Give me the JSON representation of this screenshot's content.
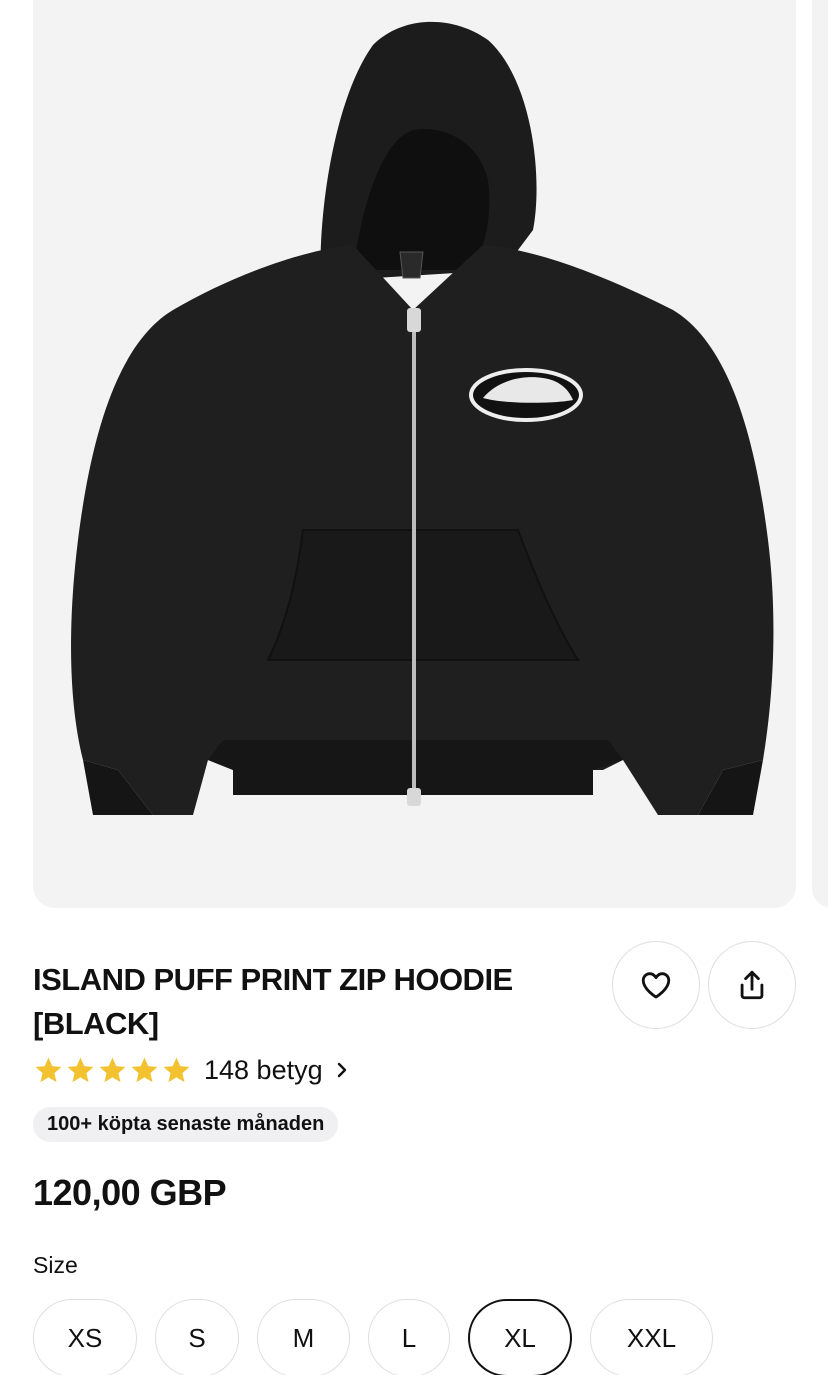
{
  "product": {
    "title": "ISLAND PUFF PRINT ZIP HOODIE [BLACK]",
    "image_alt": "Black zip hoodie with white oval island logo on chest",
    "rating": {
      "stars": 5,
      "star_color": "#F2C230",
      "count_label": "148 betyg"
    },
    "badge": "100+ köpta senaste månaden",
    "price": "120,00 GBP"
  },
  "actions": {
    "favorite_icon": "heart-icon",
    "share_icon": "share-icon"
  },
  "sizes": {
    "label": "Size",
    "options": [
      "XS",
      "S",
      "M",
      "L",
      "XL",
      "XXL"
    ],
    "selected": "XL"
  }
}
